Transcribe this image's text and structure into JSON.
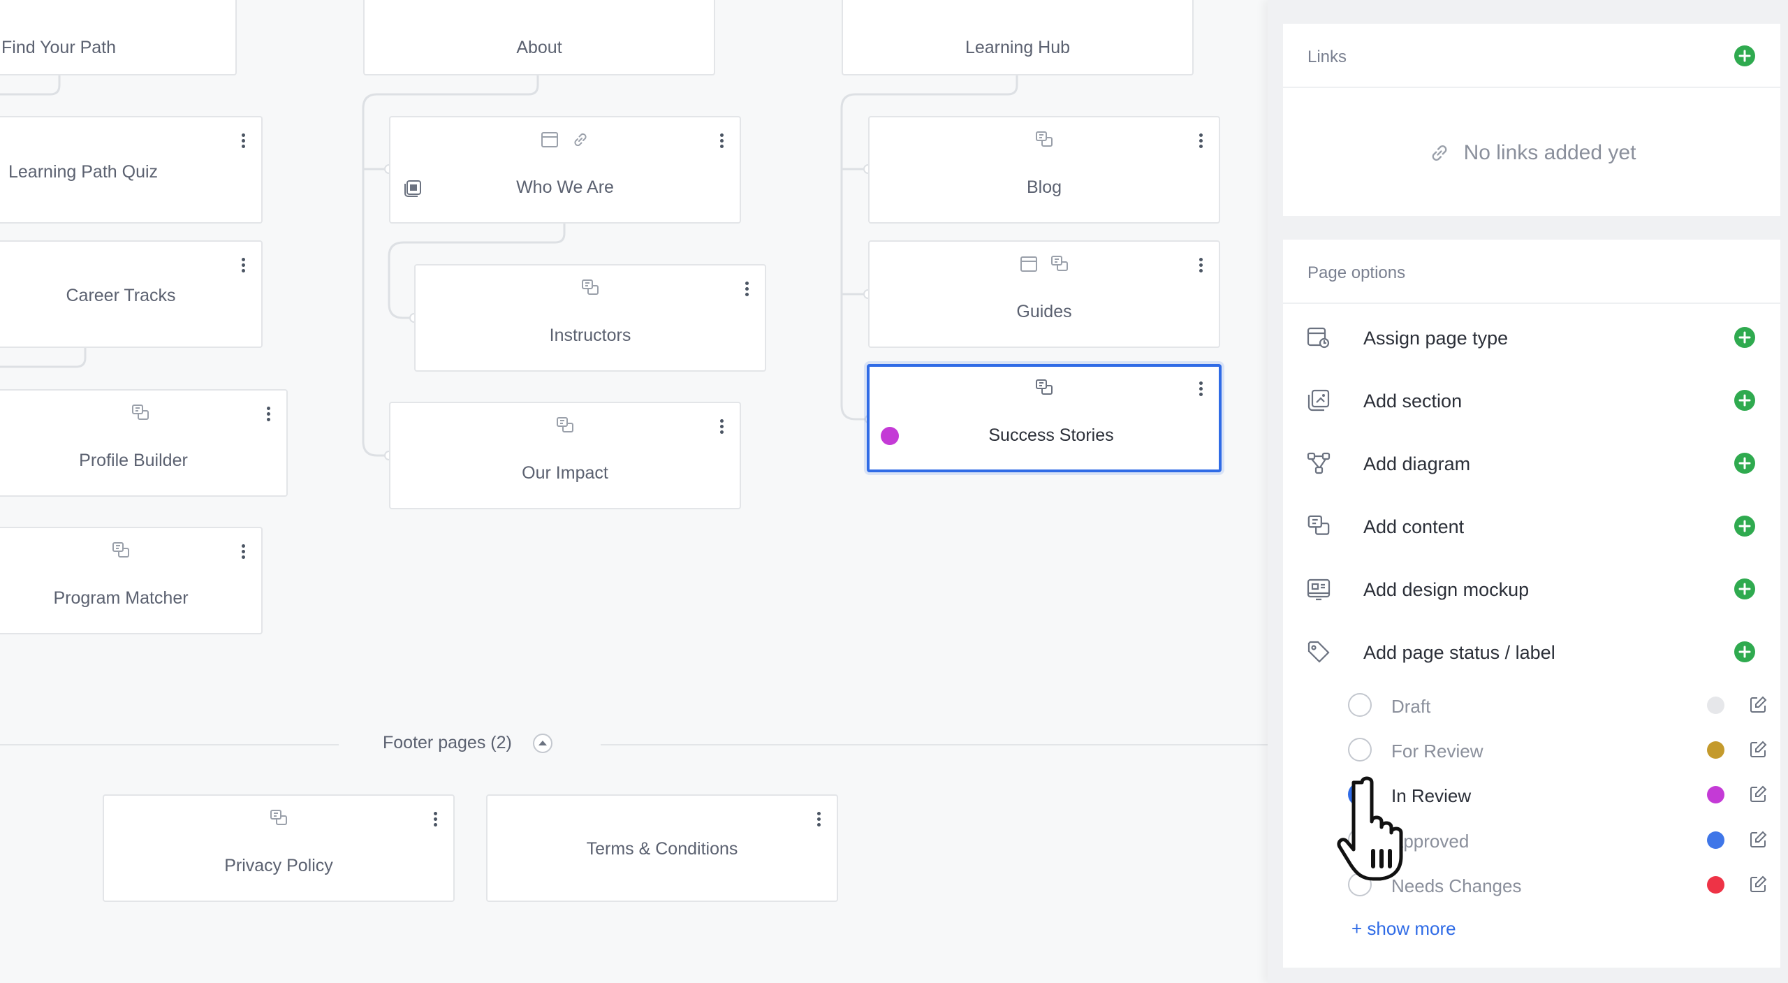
{
  "sitemap": {
    "columns": [
      {
        "parent": "Find Your Path",
        "children": [
          "Learning Path Quiz",
          "Career Tracks",
          "Profile Builder",
          "Program Matcher"
        ]
      },
      {
        "parent": "About",
        "children": [
          "Who We Are",
          "Instructors",
          "Our Impact"
        ]
      },
      {
        "parent": "Learning Hub",
        "children": [
          "Blog",
          "Guides",
          "Success Stories"
        ]
      }
    ],
    "selected_page": "Success Stories",
    "selected_status_color": "#c43ad6"
  },
  "footer": {
    "label": "Footer pages (2)",
    "pages": [
      "Privacy Policy",
      "Terms & Conditions"
    ]
  },
  "panel": {
    "links": {
      "title": "Links",
      "empty_text": "No links added yet"
    },
    "page_options": {
      "title": "Page options",
      "items": [
        {
          "label": "Assign page type",
          "icon": "page-type-icon"
        },
        {
          "label": "Add section",
          "icon": "section-icon"
        },
        {
          "label": "Add diagram",
          "icon": "diagram-icon"
        },
        {
          "label": "Add content",
          "icon": "content-icon"
        },
        {
          "label": "Add design mockup",
          "icon": "mockup-icon"
        },
        {
          "label": "Add page status / label",
          "icon": "tag-icon"
        }
      ],
      "statuses": [
        {
          "label": "Draft",
          "color": "#e6e7ea",
          "checked": false
        },
        {
          "label": "For Review",
          "color": "#c49a2c",
          "checked": false
        },
        {
          "label": "In Review",
          "color": "#c43ad6",
          "checked": true
        },
        {
          "label": "Approved",
          "color": "#3f76e8",
          "checked": false
        },
        {
          "label": "Needs Changes",
          "color": "#ee3346",
          "checked": false
        }
      ],
      "show_more": "+ show more"
    },
    "colors": {
      "accent": "#2f6be6",
      "add_green": "#2faa4f"
    }
  }
}
